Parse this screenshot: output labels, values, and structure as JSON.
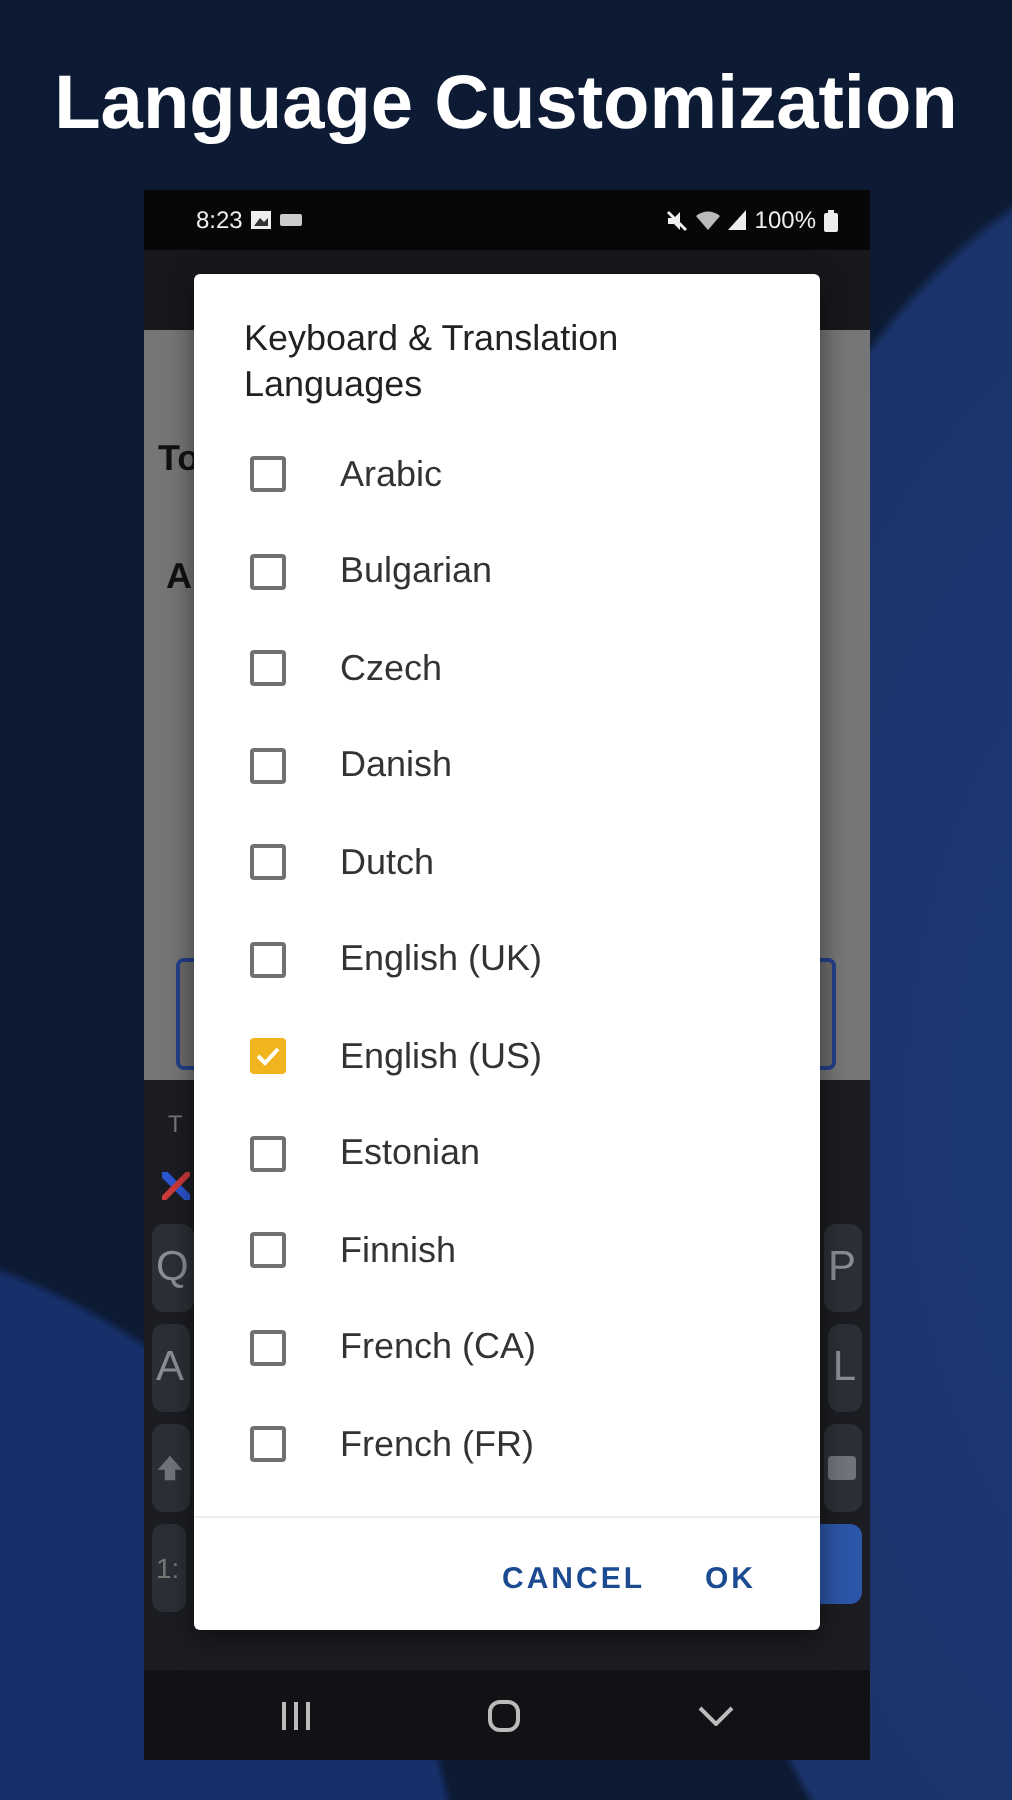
{
  "headline": "Language Customization",
  "status_bar": {
    "time": "8:23",
    "battery": "100%"
  },
  "screen_behind": {
    "labels": [
      "To",
      "A"
    ],
    "keyboard_caption": "T",
    "keyboard_rows": [
      [
        "Q",
        "P"
      ],
      [
        "A",
        "L"
      ]
    ],
    "bottom_key": "1:"
  },
  "dialog": {
    "title": "Keyboard & Translation Languages",
    "options": [
      {
        "label": "Arabic",
        "checked": false
      },
      {
        "label": "Bulgarian",
        "checked": false
      },
      {
        "label": "Czech",
        "checked": false
      },
      {
        "label": "Danish",
        "checked": false
      },
      {
        "label": "Dutch",
        "checked": false
      },
      {
        "label": "English (UK)",
        "checked": false
      },
      {
        "label": "English (US)",
        "checked": true
      },
      {
        "label": "Estonian",
        "checked": false
      },
      {
        "label": "Finnish",
        "checked": false
      },
      {
        "label": "French (CA)",
        "checked": false
      },
      {
        "label": "French (FR)",
        "checked": false
      }
    ],
    "buttons": [
      "CANCEL",
      "OK"
    ]
  }
}
